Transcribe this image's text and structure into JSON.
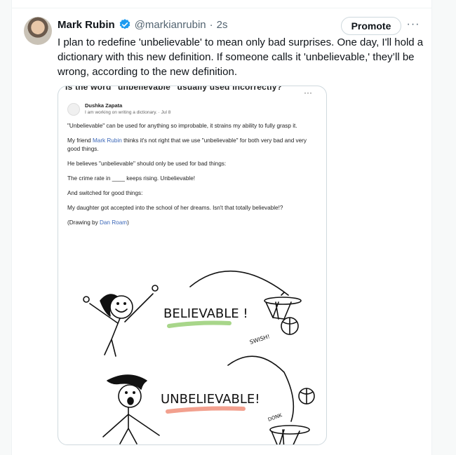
{
  "post": {
    "author_name": "Mark Rubin",
    "handle": "@markianrubin",
    "time": "2s",
    "separator": "·",
    "promote_label": "Promote",
    "more_label": "···",
    "text": "I plan to redefine 'unbelievable' to mean only bad surprises. One day, I'll hold a dictionary with this new definition. If someone calls it 'unbelievable,' they’ll be wrong, according to the new definition."
  },
  "media": {
    "question_title": "Is the word \"unbelievable\" usually used incorrectly?",
    "more_label": "···",
    "answer_author": "Dushka Zapata",
    "answer_sub": "I am working on writing a dictionary. · Jul 8",
    "p1": "\"Unbelievable\" can be used for anything so improbable, it strains my ability to fully grasp it.",
    "p2_before": "My friend ",
    "p2_link": "Mark Rubin",
    "p2_after": " thinks it's not right that we use \"unbelievable\" for both very bad and very good things.",
    "p3": "He believes \"unbelievable\" should only be used for bad things:",
    "p4": "The crime rate in ____ keeps rising. Unbelievable!",
    "p5": "And switched for good things:",
    "p6": "My daughter got accepted into the school of her dreams. Isn't that totally believable!?",
    "p7_before": "(Drawing by ",
    "p7_link": "Dan Roam",
    "p7_after": ")",
    "drawing": {
      "word_good": "BELIEVABLE !",
      "word_bad": "UNBELIEVABLE!",
      "sfx_good": "SWISH!",
      "sfx_bad": "DONK",
      "good_underline_color": "#a8d68a",
      "bad_underline_color": "#f2a08e"
    }
  },
  "colors": {
    "verified_blue": "#1d9bf0",
    "link_blue": "#3b67b8"
  }
}
